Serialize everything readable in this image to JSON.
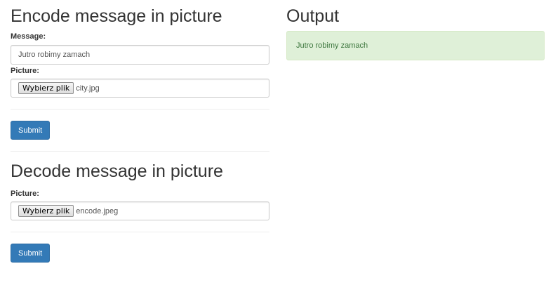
{
  "encode": {
    "title": "Encode message in picture",
    "message_label": "Message:",
    "message_value": "Jutro robimy zamach",
    "picture_label": "Picture:",
    "file_button_label": "Wybierz plik",
    "file_name": "city.jpg",
    "submit_label": "Submit"
  },
  "decode": {
    "title": "Decode message in picture",
    "picture_label": "Picture:",
    "file_button_label": "Wybierz plik",
    "file_name": "encode.jpeg",
    "submit_label": "Submit"
  },
  "output": {
    "title": "Output",
    "result_text": "Jutro robimy zamach"
  },
  "colors": {
    "primary": "#337ab7",
    "success_bg": "#dff0d8",
    "success_text": "#3c763d"
  }
}
